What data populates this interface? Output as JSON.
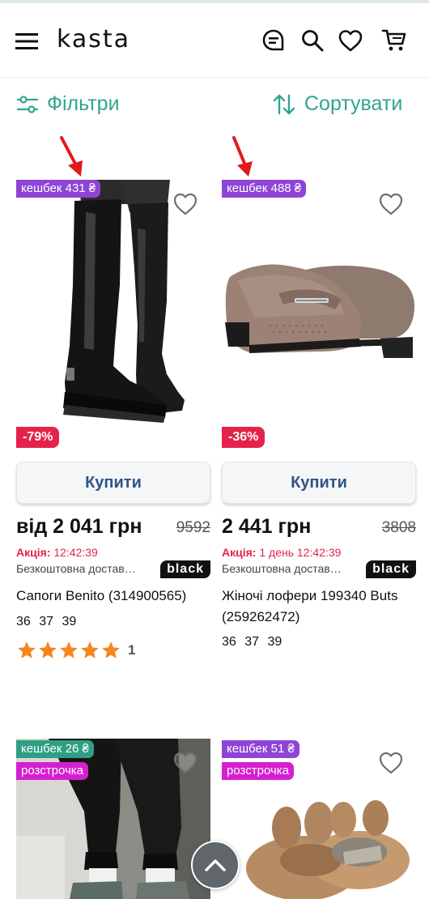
{
  "header": {
    "logo": "kasta",
    "icons": [
      "menu-icon",
      "chat-icon",
      "search-icon",
      "heart-icon",
      "cart-icon"
    ]
  },
  "toolbar": {
    "filters_label": "Фільтри",
    "sort_label": "Сортувати",
    "accent_color": "#2fa58f"
  },
  "products": [
    {
      "cashback": "кешбек 431 ₴",
      "discount": "-79%",
      "buy_label": "Купити",
      "price": "від 2 041 грн",
      "old_price": "9592",
      "promo_label": "Акція:",
      "promo_time": "12:42:39",
      "shipping": "Безкоштовна достав…",
      "badge": "black",
      "title": "Сапоги Benito (314900565)",
      "sizes": "36 37 39",
      "rating": 5,
      "rating_count": "1"
    },
    {
      "cashback": "кешбек 488 ₴",
      "discount": "-36%",
      "buy_label": "Купити",
      "price": "2 441 грн",
      "old_price": "3808",
      "promo_label": "Акція:",
      "promo_time": "1 день 12:42:39",
      "shipping": "Безкоштовна достав…",
      "badge": "black",
      "title": "Жіночі лофери 199340 Buts (259262472)",
      "sizes": "36 37 39"
    },
    {
      "cashback": "кешбек 26 ₴",
      "installment": "розстрочка"
    },
    {
      "cashback": "кешбек 51 ₴",
      "installment": "розстрочка"
    }
  ],
  "colors": {
    "cashback_purple": "#8e44d6",
    "cashback_green": "#2e9e84",
    "installment": "#d61fd0",
    "discount": "#e5224b",
    "buy_text": "#2f5486"
  }
}
